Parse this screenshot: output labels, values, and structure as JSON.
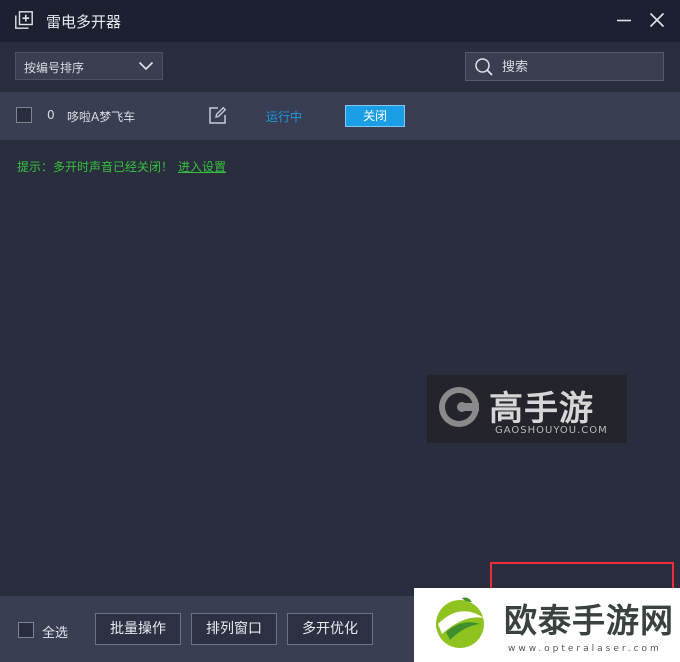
{
  "window": {
    "title": "雷电多开器"
  },
  "toolbar": {
    "sort_label": "按编号排序",
    "search_placeholder": "搜索"
  },
  "instances": [
    {
      "index": "0",
      "name": "哆啦A梦飞车",
      "status": "运行中",
      "action_label": "关闭"
    }
  ],
  "tip": {
    "text": "提示：多开时声音已经关闭！",
    "link_label": "进入设置"
  },
  "watermark": {
    "name": "高手游",
    "domain": "GAOSHOUYOU.COM"
  },
  "bottombar": {
    "select_all_label": "全选",
    "buttons": [
      "批量操作",
      "排列窗口",
      "多开优化"
    ]
  },
  "brand_overlay": {
    "name": "欧泰手游网",
    "url": "www.opteralaser.com"
  },
  "colors": {
    "accent": "#1a9fe6",
    "status_running": "#1e98e0",
    "tip_text": "#36c13d",
    "highlight_box": "#ee2e37"
  }
}
